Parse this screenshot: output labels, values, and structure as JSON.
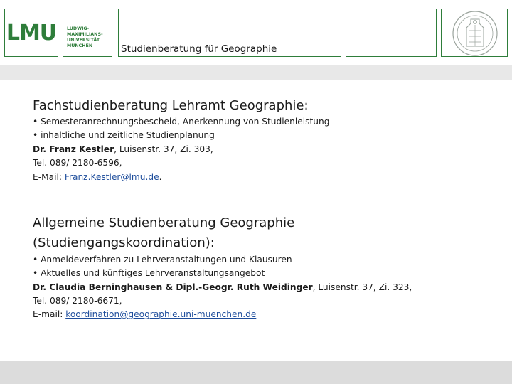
{
  "header": {
    "logo": "LMU",
    "university_lines": [
      "LUDWIG-",
      "MAXIMILIANS-",
      "UNIVERSITÄT",
      "MÜNCHEN"
    ],
    "title": "Studienberatung für Geographie",
    "accent_color": "#2e7d3a"
  },
  "section1": {
    "heading": "Fachstudienberatung Lehramt Geographie",
    "heading_suffix": ":",
    "bullets": [
      "• Semesteranrechnungsbescheid, Anerkennung von Studienleistung",
      "• inhaltliche und zeitliche Studienplanung"
    ],
    "contact_name": "Dr. Franz Kestler",
    "contact_address": ", Luisenstr. 37, Zi. 303,",
    "tel": "Tel. 089/ 2180-6596,",
    "email_label": "E-Mail: ",
    "email": "Franz.Kestler@lmu.de",
    "email_suffix": "."
  },
  "section2": {
    "heading_line1": "Allgemeine Studienberatung Geographie",
    "heading_line2": "(Studiengangskoordination):",
    "bullets": [
      "• Anmeldeverfahren zu Lehrveranstaltungen und Klausuren",
      "• Aktuelles und künftiges Lehrveranstaltungsangebot"
    ],
    "contact_name": "Dr. Claudia Berninghausen & Dipl.-Geogr. Ruth Weidinger",
    "contact_address": ", Luisenstr. 37, Zi. 323,",
    "tel": "Tel. 089/ 2180-6671,",
    "email_label": "E-mail: ",
    "email": "koordination@geographie.uni-muenchen.de"
  }
}
